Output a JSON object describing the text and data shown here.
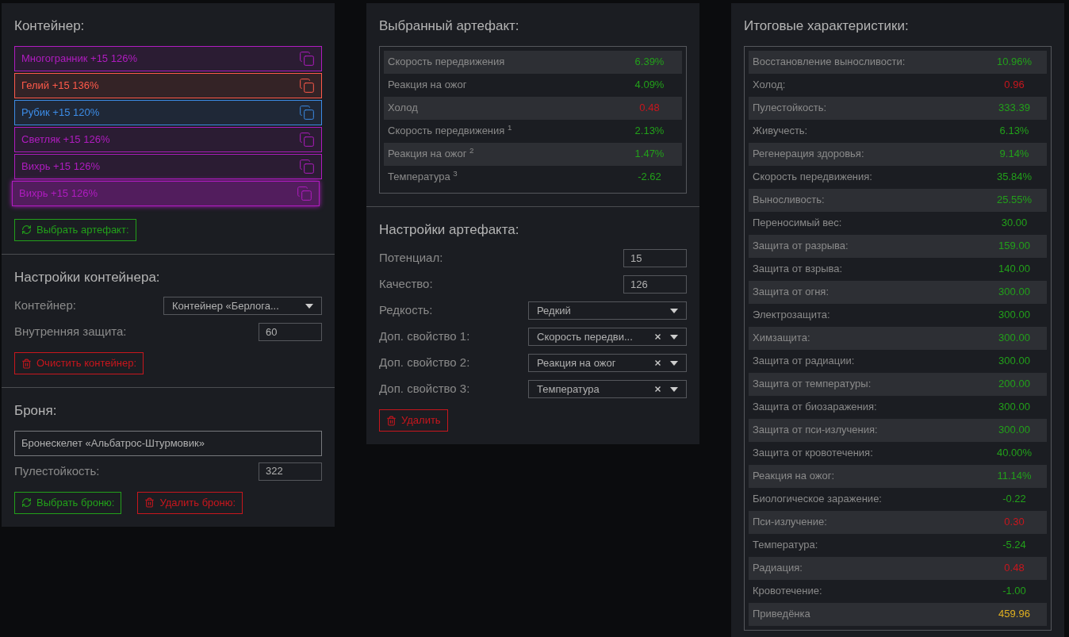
{
  "container_panel": {
    "title": "Контейнер:",
    "artifacts": [
      {
        "label": "Многогранник +15 126%",
        "color": "#b01cc0",
        "highlighted": false
      },
      {
        "label": "Гелий +15 136%",
        "color": "#ff5a4a",
        "highlighted": false
      },
      {
        "label": "Рубик +15 120%",
        "color": "#3c8ce6",
        "highlighted": false
      },
      {
        "label": "Светляк +15 126%",
        "color": "#b01cc0",
        "highlighted": false
      },
      {
        "label": "Вихрь +15 126%",
        "color": "#b01cc0",
        "highlighted": false
      },
      {
        "label": "Вихрь +15 126%",
        "color": "#b01cc0",
        "highlighted": true
      }
    ],
    "choose_button": "Выбрать артефакт:"
  },
  "container_settings": {
    "title": "Настройки контейнера:",
    "fields": [
      {
        "kind": "select",
        "label": "Контейнер:",
        "value": "Контейнер «Берлога...",
        "clearable": false
      },
      {
        "kind": "input",
        "label": "Внутренняя защита:",
        "value": "60"
      }
    ],
    "clear_button": "Очистить контейнер:"
  },
  "armor": {
    "title": "Броня:",
    "name": "Бронескелет «Альбатрос-Штурмовик»",
    "fields": [
      {
        "kind": "input",
        "label": "Пулестойкость:",
        "value": "322"
      }
    ],
    "choose_button": "Выбрать броню:",
    "delete_button": "Удалить броню:"
  },
  "selected_artifact": {
    "title": "Выбранный артефакт:",
    "stats": [
      {
        "name": "Скорость передвижения",
        "value": "6.39%",
        "color": "#22a01a"
      },
      {
        "name": "Реакция на ожог",
        "value": "4.09%",
        "color": "#22a01a"
      },
      {
        "name": "Холод",
        "value": "0.48",
        "color": "#c8161d"
      },
      {
        "name": "Скорость передвижения $^{1}$",
        "value": "2.13%",
        "color": "#22a01a"
      },
      {
        "name": "Реакция на ожог $^{2}$",
        "value": "1.47%",
        "color": "#22a01a"
      },
      {
        "name": "Температура $^{3}$",
        "value": "-2.62",
        "color": "#22a01a"
      }
    ]
  },
  "artifact_settings": {
    "title": "Настройки артефакта:",
    "fields": [
      {
        "kind": "input",
        "label": "Потенциал:",
        "value": "15"
      },
      {
        "kind": "input",
        "label": "Качество:",
        "value": "126"
      },
      {
        "kind": "select",
        "label": "Редкость:",
        "value": "Редкий",
        "clearable": false
      },
      {
        "kind": "select",
        "label": "Доп. свойство 1:",
        "value": "Скорость передви...",
        "clearable": true
      },
      {
        "kind": "select",
        "label": "Доп. свойство 2:",
        "value": "Реакция на ожог",
        "clearable": true
      },
      {
        "kind": "select",
        "label": "Доп. свойство 3:",
        "value": "Температура",
        "clearable": true
      }
    ],
    "delete_button": "Удалить"
  },
  "totals": {
    "title": "Итоговые характеристики:",
    "stats": [
      {
        "name": "Восстановление выносливости:",
        "value": "10.96%",
        "color": "#22a01a"
      },
      {
        "name": "Холод:",
        "value": "0.96",
        "color": "#c8161d"
      },
      {
        "name": "Пулестойкость:",
        "value": "333.39",
        "color": "#22a01a"
      },
      {
        "name": "Живучесть:",
        "value": "6.13%",
        "color": "#22a01a"
      },
      {
        "name": "Регенерация здоровья:",
        "value": "9.14%",
        "color": "#22a01a"
      },
      {
        "name": "Скорость передвижения:",
        "value": "35.84%",
        "color": "#22a01a"
      },
      {
        "name": "Выносливость:",
        "value": "25.55%",
        "color": "#22a01a"
      },
      {
        "name": "Переносимый вес:",
        "value": "30.00",
        "color": "#22a01a"
      },
      {
        "name": "Защита от разрыва:",
        "value": "159.00",
        "color": "#22a01a"
      },
      {
        "name": "Защита от взрыва:",
        "value": "140.00",
        "color": "#22a01a"
      },
      {
        "name": "Защита от огня:",
        "value": "300.00",
        "color": "#22a01a"
      },
      {
        "name": "Электрозащита:",
        "value": "300.00",
        "color": "#22a01a"
      },
      {
        "name": "Химзащита:",
        "value": "300.00",
        "color": "#22a01a"
      },
      {
        "name": "Защита от радиации:",
        "value": "300.00",
        "color": "#22a01a"
      },
      {
        "name": "Защита от температуры:",
        "value": "200.00",
        "color": "#22a01a"
      },
      {
        "name": "Защита от биозаражения:",
        "value": "300.00",
        "color": "#22a01a"
      },
      {
        "name": "Защита от пси-излучения:",
        "value": "300.00",
        "color": "#22a01a"
      },
      {
        "name": "Защита от кровотечения:",
        "value": "40.00%",
        "color": "#22a01a"
      },
      {
        "name": "Реакция на ожог:",
        "value": "11.14%",
        "color": "#22a01a"
      },
      {
        "name": "Биологическое заражение:",
        "value": "-0.22",
        "color": "#22a01a"
      },
      {
        "name": "Пси-излучение:",
        "value": "0.30",
        "color": "#c8161d"
      },
      {
        "name": "Температура:",
        "value": "-5.24",
        "color": "#22a01a"
      },
      {
        "name": "Радиация:",
        "value": "0.48",
        "color": "#c8161d"
      },
      {
        "name": "Кровотечение:",
        "value": "-1.00",
        "color": "#22a01a"
      },
      {
        "name": "Приведёнка",
        "value": "459.96",
        "color": "#e0b020"
      }
    ]
  }
}
